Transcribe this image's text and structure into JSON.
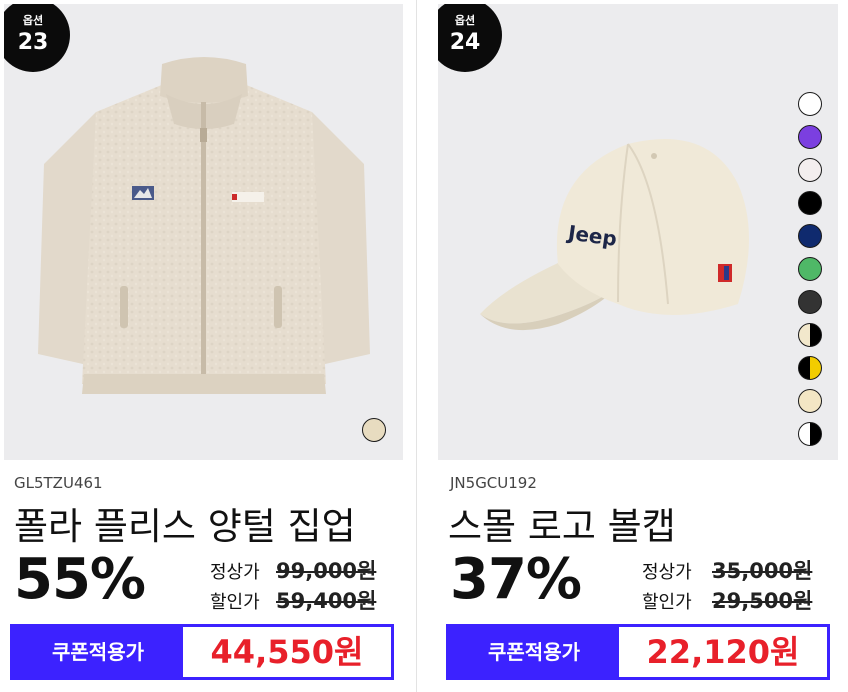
{
  "products": [
    {
      "option_label": "옵션",
      "option_number": "23",
      "code": "GL5TZU461",
      "name": "폴라 플리스 양털 집업",
      "discount_rate": "55%",
      "regular_label": "정상가",
      "regular_price": "99,000원",
      "sale_label": "할인가",
      "sale_price": "59,400원",
      "coupon_label": "쿠폰적용가",
      "coupon_price": "44,550원",
      "swatches": [
        "#e8dcc0"
      ]
    },
    {
      "option_label": "옵션",
      "option_number": "24",
      "code": "JN5GCU192",
      "name": "스몰 로고 볼캡",
      "discount_rate": "37%",
      "regular_label": "정상가",
      "regular_price": "35,000원",
      "sale_label": "할인가",
      "sale_price": "29,500원",
      "coupon_label": "쿠폰적용가",
      "coupon_price": "22,120원",
      "swatches": [
        "#ffffff",
        "#7b3fe0",
        "#f3eeee",
        "#000000",
        "#0f2a6e",
        "#4fb867",
        "#333333",
        "#f2e8cc/#000000",
        "#000000/#f2cc00",
        "#f3e6c4",
        "#ffffff/#000000"
      ]
    }
  ],
  "colors": {
    "accent": "#3c22ff",
    "coupon_price": "#e8202a",
    "image_bg": "#ececee"
  }
}
